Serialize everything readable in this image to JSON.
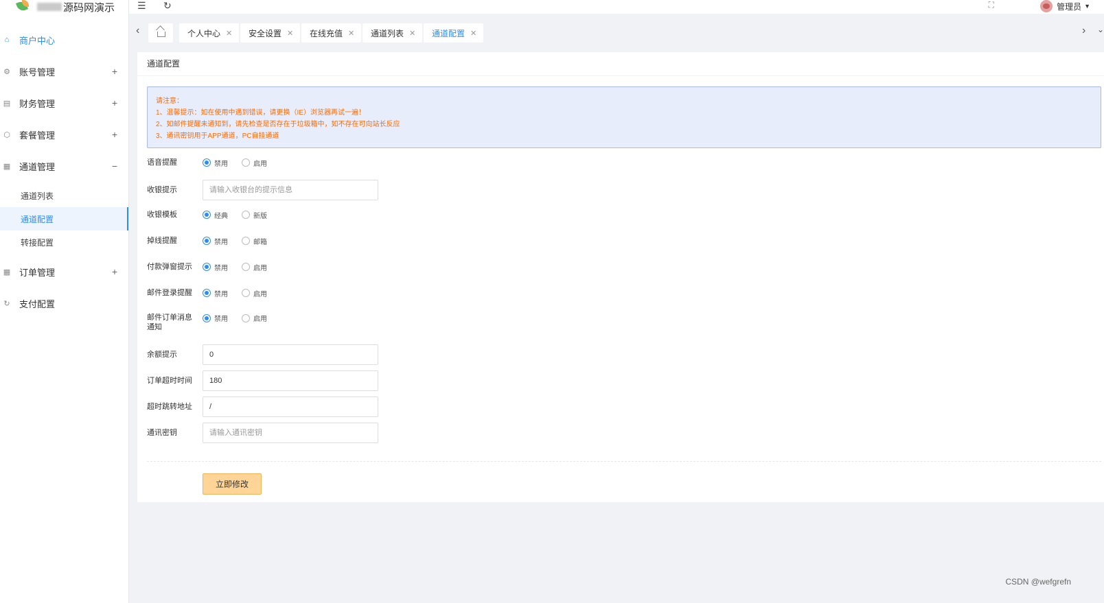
{
  "app": {
    "title_visible": "源码网演示"
  },
  "sidebar": {
    "items": [
      {
        "label": "商户中心",
        "icon": "home-icon",
        "toggle": ""
      },
      {
        "label": "账号管理",
        "icon": "gear-icon",
        "toggle": "+"
      },
      {
        "label": "财务管理",
        "icon": "finance-icon",
        "toggle": "+"
      },
      {
        "label": "套餐管理",
        "icon": "package-icon",
        "toggle": "+"
      },
      {
        "label": "通道管理",
        "icon": "channel-icon",
        "toggle": "−"
      },
      {
        "label": "订单管理",
        "icon": "order-icon",
        "toggle": "+"
      },
      {
        "label": "支付配置",
        "icon": "pay-config-icon",
        "toggle": ""
      }
    ],
    "sub_items": [
      {
        "label": "通道列表"
      },
      {
        "label": "通道配置"
      },
      {
        "label": "转接配置"
      }
    ]
  },
  "header": {
    "user": "管理员",
    "menu_icon": "☰",
    "refresh_icon": "↻",
    "fullscreen_icon": "⛶"
  },
  "tabs": [
    {
      "label": "个人中心"
    },
    {
      "label": "安全设置"
    },
    {
      "label": "在线充值"
    },
    {
      "label": "通道列表"
    },
    {
      "label": "通道配置"
    }
  ],
  "card": {
    "title": "通道配置"
  },
  "notice": {
    "heading": "请注意：",
    "lines": [
      "1、温馨提示：如在使用中遇到错误，请更换（IE）浏览器再试一遍！",
      "2、如邮件提醒未通知到，请先检查是否存在于垃圾箱中，如不存在可向站长反应",
      "3、通讯密钥用于APP通道，PC自挂通道"
    ]
  },
  "form": {
    "voice": {
      "label": "语音提醒",
      "opt1": "禁用",
      "opt2": "启用"
    },
    "cashier_tip": {
      "label": "收银提示",
      "placeholder": "请输入收银台的提示信息"
    },
    "cashier_template": {
      "label": "收银模板",
      "opt1": "经典",
      "opt2": "新版"
    },
    "offline": {
      "label": "掉线提醒",
      "opt1": "禁用",
      "opt2": "邮箱"
    },
    "pay_popup": {
      "label": "付款弹窗提示",
      "opt1": "禁用",
      "opt2": "启用"
    },
    "mail_login": {
      "label": "邮件登录提醒",
      "opt1": "禁用",
      "opt2": "启用"
    },
    "mail_order": {
      "label": "邮件订单消息通知",
      "opt1": "禁用",
      "opt2": "启用"
    },
    "balance_tip": {
      "label": "余额提示",
      "value": "0"
    },
    "order_timeout": {
      "label": "订单超时时间",
      "value": "180"
    },
    "timeout_redirect": {
      "label": "超时跳转地址",
      "value": "/"
    },
    "secret": {
      "label": "通讯密钥",
      "placeholder": "请输入通讯密钥"
    },
    "submit_label": "立即修改"
  },
  "watermark": "CSDN @wefgrefn",
  "colors": {
    "accent": "#2d8cf0",
    "notice_text": "#ff6a00",
    "notice_bg": "#e8edfb",
    "submit_bg": "#ffd597"
  }
}
